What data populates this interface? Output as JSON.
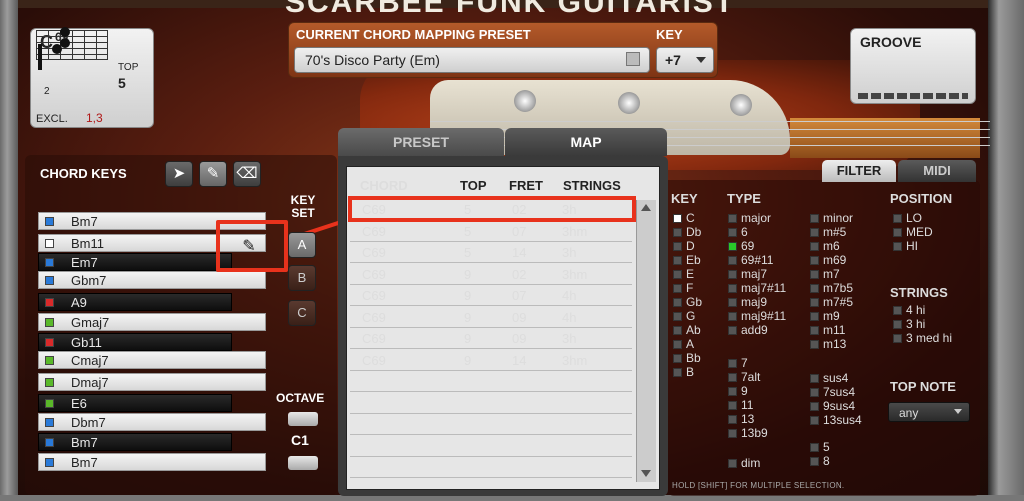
{
  "app": {
    "brand_title": "SCARBEE FUNK GUITARIST"
  },
  "chord_diagram": {
    "name": "C",
    "name_sup": "69",
    "fret_number": "2",
    "top_label": "TOP",
    "top_value": "5",
    "excl_label": "EXCL.",
    "excl_value": "1,3"
  },
  "preset": {
    "label": "CURRENT CHORD MAPPING PRESET",
    "value": "70's Disco Party (Em)",
    "key_label": "KEY",
    "key_value": "+7"
  },
  "groove": {
    "label": "GROOVE"
  },
  "tabs": {
    "preset": "PRESET",
    "map": "MAP",
    "filter": "FILTER",
    "midi": "MIDI"
  },
  "chord_keys": {
    "title": "CHORD KEYS",
    "tools": {
      "select": "➤",
      "pencil": "✎",
      "eraser": "⌫"
    },
    "items": [
      {
        "label": "Bm7",
        "type": "white",
        "sq": "#2a7ad8"
      },
      {
        "label": "Bm11",
        "type": "white",
        "sq": "#ffffff"
      },
      {
        "label": "Em7",
        "type": "black",
        "sq": "#2a7ad8"
      },
      {
        "label": "Gbm7",
        "type": "white",
        "sq": "#2a7ad8"
      },
      {
        "label": "A9",
        "type": "black",
        "sq": "#d82a2a"
      },
      {
        "label": "Gmaj7",
        "type": "white",
        "sq": "#5ab82a"
      },
      {
        "label": "Gb11",
        "type": "black",
        "sq": "#d82a2a"
      },
      {
        "label": "Cmaj7",
        "type": "white",
        "sq": "#5ab82a"
      },
      {
        "label": "Dmaj7",
        "type": "white",
        "sq": "#5ab82a"
      },
      {
        "label": "E6",
        "type": "black",
        "sq": "#5ab82a"
      },
      {
        "label": "Dbm7",
        "type": "white",
        "sq": "#2a7ad8"
      },
      {
        "label": "Bm7",
        "type": "black",
        "sq": "#2a7ad8"
      },
      {
        "label": "Bm7",
        "type": "white",
        "sq": "#2a7ad8"
      }
    ],
    "edit_icon": "✎"
  },
  "key_set": {
    "label": "KEY SET",
    "a": "A",
    "b": "B",
    "c": "C"
  },
  "octave": {
    "label": "OCTAVE",
    "value": "C1"
  },
  "map": {
    "headers": {
      "chord": "CHORD",
      "top": "TOP",
      "fret": "FRET",
      "strings": "STRINGS"
    },
    "rows": [
      {
        "chord": "C69",
        "top": "5",
        "fret": "02",
        "strings": "3h"
      },
      {
        "chord": "C69",
        "top": "5",
        "fret": "07",
        "strings": "3hm"
      },
      {
        "chord": "C69",
        "top": "5",
        "fret": "14",
        "strings": "3h"
      },
      {
        "chord": "C69",
        "top": "9",
        "fret": "02",
        "strings": "3hm"
      },
      {
        "chord": "C69",
        "top": "9",
        "fret": "07",
        "strings": "4h"
      },
      {
        "chord": "C69",
        "top": "9",
        "fret": "09",
        "strings": "4h"
      },
      {
        "chord": "C69",
        "top": "9",
        "fret": "09",
        "strings": "3h"
      },
      {
        "chord": "C69",
        "top": "9",
        "fret": "14",
        "strings": "3hm"
      }
    ]
  },
  "filter": {
    "key_head": "KEY",
    "keys": [
      "C",
      "Db",
      "D",
      "Eb",
      "E",
      "F",
      "Gb",
      "G",
      "Ab",
      "A",
      "Bb",
      "B"
    ],
    "type_head": "TYPE",
    "types_col1a": [
      "major",
      "6",
      "69",
      "69#11",
      "maj7",
      "maj7#11",
      "maj9",
      "maj9#11",
      "add9"
    ],
    "types_col1b": [
      "7",
      "7alt",
      "9",
      "11",
      "13",
      "13b9"
    ],
    "types_col1c": [
      "dim"
    ],
    "types_col2a": [
      "minor",
      "m#5",
      "m6",
      "m69",
      "m7",
      "m7b5",
      "m7#5",
      "m9",
      "m11",
      "m13"
    ],
    "types_col2b": [
      "sus4",
      "7sus4",
      "9sus4",
      "13sus4"
    ],
    "types_col2c": [
      "5",
      "8"
    ],
    "position_head": "POSITION",
    "positions": [
      "LO",
      "MED",
      "HI"
    ],
    "strings_head": "STRINGS",
    "strings": [
      "4 hi",
      "3 hi",
      "3 med hi"
    ],
    "top_note_head": "TOP NOTE",
    "top_note_value": "any",
    "hint": "HOLD [SHIFT] FOR MULTIPLE SELECTION."
  },
  "colors": {
    "accent_red": "#e8321c",
    "selected_green": "#29c829"
  }
}
